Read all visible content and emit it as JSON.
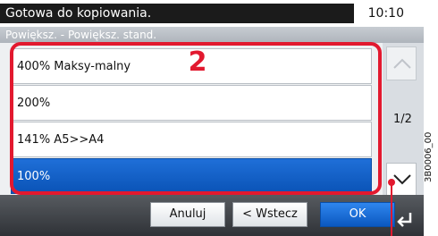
{
  "status": {
    "message": "Gotowa do kopiowania.",
    "time": "10:10"
  },
  "breadcrumb": "Powiększ. - Powiększ. stand.",
  "items": [
    {
      "label": "400% Maksy-malny"
    },
    {
      "label": "200%"
    },
    {
      "label": "141% A5>>A4"
    },
    {
      "label": "100%",
      "selected": true
    }
  ],
  "callout": "2",
  "page_indicator": "1/2",
  "buttons": {
    "cancel": "Anuluj",
    "back": "< Wstecz",
    "ok": "OK"
  },
  "ref_code": "3B0006_00",
  "colors": {
    "selection": "#0a5ac4",
    "callout": "#e2192f",
    "ok": "#0b58c0"
  }
}
